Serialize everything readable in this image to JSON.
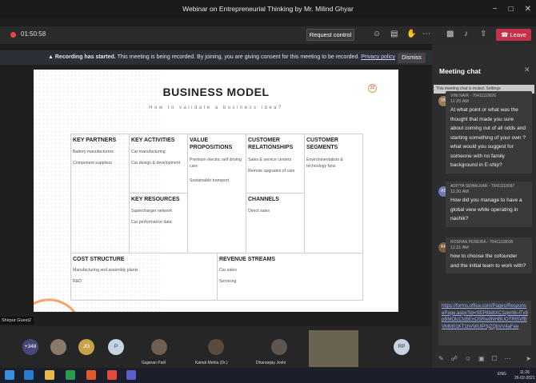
{
  "window": {
    "title": "Webinar on Entrepreneurial Thinking by Mr. Milind Ghyar",
    "controls": [
      "−",
      "□",
      "✕"
    ]
  },
  "toolbar": {
    "timer": "01:50:58",
    "request_control": "Request control",
    "leave": "Leave"
  },
  "banner": {
    "lead": "Recording has started.",
    "text": "This meeting is being recorded. By joining, you are giving consent for this meeting to be recorded.",
    "link": "Privacy policy",
    "dismiss": "Dismiss"
  },
  "slide": {
    "title": "BUSINESS MODEL",
    "subtitle": "How to validate a business idea?",
    "number": "22",
    "key_partners": {
      "head": "KEY PARTNERS",
      "items": [
        "Battery manufacturers",
        "Component suppliers"
      ]
    },
    "key_activities": {
      "head": "KEY ACTIVITIES",
      "items": [
        "Car manufacturing",
        "Car design & development"
      ]
    },
    "value_prop": {
      "head": "VALUE PROPOSITIONS",
      "items": [
        "Premium electric self driving cars",
        "Sustainable transport"
      ]
    },
    "customer_rel": {
      "head": "CUSTOMER RELATIONSHIPS",
      "items": [
        "Sales & service centers",
        "Remote upgrades of cars"
      ]
    },
    "customer_seg": {
      "head": "CUSTOMER SEGMENTS",
      "items": [
        "Environmentalists & technology fans"
      ]
    },
    "key_resources": {
      "head": "KEY RESOURCES",
      "items": [
        "Supercharger network",
        "Car performance data"
      ]
    },
    "channels": {
      "head": "CHANNELS",
      "items": [
        "Direct sales"
      ]
    },
    "cost": {
      "head": "COST STRUCTURE",
      "items": [
        "Manufacturing and assembly plants",
        "R&D"
      ]
    },
    "revenue": {
      "head": "REVENUE STREAMS",
      "items": [
        "Car sales",
        "Servicing"
      ]
    }
  },
  "presenter_label": "Shirpur Guest2",
  "chat": {
    "title": "Meeting chat",
    "muted": "This meeting chat is muted. Settings",
    "messages": [
      {
        "initials": "VN",
        "name": "VINI NAIR - 70411119026",
        "time": "11:20 AM",
        "body": "At what point or what was the thought that made you sure about coming out of all odds and starting something of your own ? what would you suggest for someone with no family background in E-ship?"
      },
      {
        "initials": "AS",
        "name": "ADITYA SEWALKAR - 70411118067",
        "time": "11:20 AM",
        "body": "How did you manage to have a global view while operating in nashik?"
      },
      {
        "initials": "RP",
        "name": "ROSHAN PEREIRA - 70411118035",
        "time": "11:21 AM",
        "body": "how to choose the cofounder and the initial team to work with?"
      }
    ],
    "draft_link": "https://forms.office.com/Pages/ResponsePage.aspx?id=SEPtIb8tXC1qwrt6i-lTv8pBMOlcCtd5EnOSRw0NHBUOTRlSVfBVMM01KT1hVWUlPSjZQbVV4aFee"
  },
  "participants": {
    "overflow": "+348",
    "people": [
      {
        "initials": "JG"
      },
      {
        "initials": "P"
      },
      {
        "name": "Gajanan Patil"
      },
      {
        "name": "Kamal Mehta (Dr.)"
      },
      {
        "name": "Dhananjay Joshi"
      },
      {
        "initials": "RP"
      }
    ]
  },
  "taskbar": {
    "time": "11:26",
    "date": "26-02-2021",
    "lang": "ENG"
  }
}
